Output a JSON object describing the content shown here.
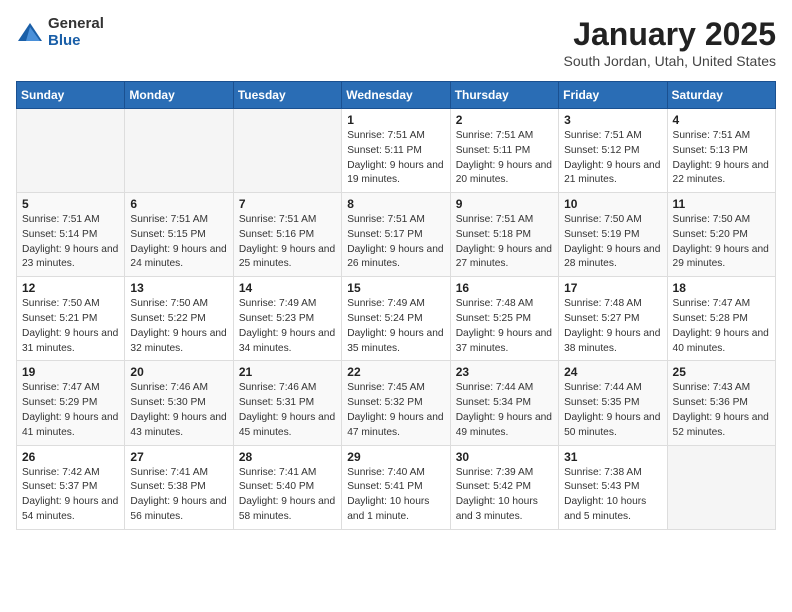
{
  "header": {
    "logo_general": "General",
    "logo_blue": "Blue",
    "title": "January 2025",
    "location": "South Jordan, Utah, United States"
  },
  "weekdays": [
    "Sunday",
    "Monday",
    "Tuesday",
    "Wednesday",
    "Thursday",
    "Friday",
    "Saturday"
  ],
  "weeks": [
    [
      {
        "day": "",
        "info": ""
      },
      {
        "day": "",
        "info": ""
      },
      {
        "day": "",
        "info": ""
      },
      {
        "day": "1",
        "info": "Sunrise: 7:51 AM\nSunset: 5:11 PM\nDaylight: 9 hours and 19 minutes."
      },
      {
        "day": "2",
        "info": "Sunrise: 7:51 AM\nSunset: 5:11 PM\nDaylight: 9 hours and 20 minutes."
      },
      {
        "day": "3",
        "info": "Sunrise: 7:51 AM\nSunset: 5:12 PM\nDaylight: 9 hours and 21 minutes."
      },
      {
        "day": "4",
        "info": "Sunrise: 7:51 AM\nSunset: 5:13 PM\nDaylight: 9 hours and 22 minutes."
      }
    ],
    [
      {
        "day": "5",
        "info": "Sunrise: 7:51 AM\nSunset: 5:14 PM\nDaylight: 9 hours and 23 minutes."
      },
      {
        "day": "6",
        "info": "Sunrise: 7:51 AM\nSunset: 5:15 PM\nDaylight: 9 hours and 24 minutes."
      },
      {
        "day": "7",
        "info": "Sunrise: 7:51 AM\nSunset: 5:16 PM\nDaylight: 9 hours and 25 minutes."
      },
      {
        "day": "8",
        "info": "Sunrise: 7:51 AM\nSunset: 5:17 PM\nDaylight: 9 hours and 26 minutes."
      },
      {
        "day": "9",
        "info": "Sunrise: 7:51 AM\nSunset: 5:18 PM\nDaylight: 9 hours and 27 minutes."
      },
      {
        "day": "10",
        "info": "Sunrise: 7:50 AM\nSunset: 5:19 PM\nDaylight: 9 hours and 28 minutes."
      },
      {
        "day": "11",
        "info": "Sunrise: 7:50 AM\nSunset: 5:20 PM\nDaylight: 9 hours and 29 minutes."
      }
    ],
    [
      {
        "day": "12",
        "info": "Sunrise: 7:50 AM\nSunset: 5:21 PM\nDaylight: 9 hours and 31 minutes."
      },
      {
        "day": "13",
        "info": "Sunrise: 7:50 AM\nSunset: 5:22 PM\nDaylight: 9 hours and 32 minutes."
      },
      {
        "day": "14",
        "info": "Sunrise: 7:49 AM\nSunset: 5:23 PM\nDaylight: 9 hours and 34 minutes."
      },
      {
        "day": "15",
        "info": "Sunrise: 7:49 AM\nSunset: 5:24 PM\nDaylight: 9 hours and 35 minutes."
      },
      {
        "day": "16",
        "info": "Sunrise: 7:48 AM\nSunset: 5:25 PM\nDaylight: 9 hours and 37 minutes."
      },
      {
        "day": "17",
        "info": "Sunrise: 7:48 AM\nSunset: 5:27 PM\nDaylight: 9 hours and 38 minutes."
      },
      {
        "day": "18",
        "info": "Sunrise: 7:47 AM\nSunset: 5:28 PM\nDaylight: 9 hours and 40 minutes."
      }
    ],
    [
      {
        "day": "19",
        "info": "Sunrise: 7:47 AM\nSunset: 5:29 PM\nDaylight: 9 hours and 41 minutes."
      },
      {
        "day": "20",
        "info": "Sunrise: 7:46 AM\nSunset: 5:30 PM\nDaylight: 9 hours and 43 minutes."
      },
      {
        "day": "21",
        "info": "Sunrise: 7:46 AM\nSunset: 5:31 PM\nDaylight: 9 hours and 45 minutes."
      },
      {
        "day": "22",
        "info": "Sunrise: 7:45 AM\nSunset: 5:32 PM\nDaylight: 9 hours and 47 minutes."
      },
      {
        "day": "23",
        "info": "Sunrise: 7:44 AM\nSunset: 5:34 PM\nDaylight: 9 hours and 49 minutes."
      },
      {
        "day": "24",
        "info": "Sunrise: 7:44 AM\nSunset: 5:35 PM\nDaylight: 9 hours and 50 minutes."
      },
      {
        "day": "25",
        "info": "Sunrise: 7:43 AM\nSunset: 5:36 PM\nDaylight: 9 hours and 52 minutes."
      }
    ],
    [
      {
        "day": "26",
        "info": "Sunrise: 7:42 AM\nSunset: 5:37 PM\nDaylight: 9 hours and 54 minutes."
      },
      {
        "day": "27",
        "info": "Sunrise: 7:41 AM\nSunset: 5:38 PM\nDaylight: 9 hours and 56 minutes."
      },
      {
        "day": "28",
        "info": "Sunrise: 7:41 AM\nSunset: 5:40 PM\nDaylight: 9 hours and 58 minutes."
      },
      {
        "day": "29",
        "info": "Sunrise: 7:40 AM\nSunset: 5:41 PM\nDaylight: 10 hours and 1 minute."
      },
      {
        "day": "30",
        "info": "Sunrise: 7:39 AM\nSunset: 5:42 PM\nDaylight: 10 hours and 3 minutes."
      },
      {
        "day": "31",
        "info": "Sunrise: 7:38 AM\nSunset: 5:43 PM\nDaylight: 10 hours and 5 minutes."
      },
      {
        "day": "",
        "info": ""
      }
    ]
  ]
}
